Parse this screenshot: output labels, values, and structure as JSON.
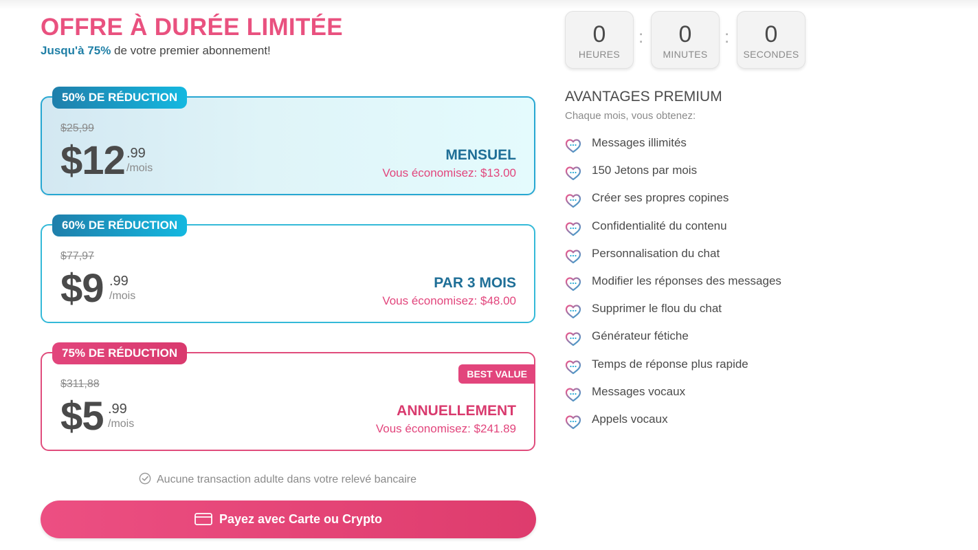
{
  "offer": {
    "headline": "OFFRE À DURÉE LIMITÉE",
    "subline_highlight": "Jusqu'à 75%",
    "subline_rest": " de votre premier abonnement!"
  },
  "plans": [
    {
      "badge": "50% DE RÉDUCTION",
      "old_price": "$25,99",
      "price_main": "$12",
      "price_cents": ".99",
      "per": "/mois",
      "name": "MENSUEL",
      "savings": "Vous économisez: $13.00",
      "selected": true
    },
    {
      "badge": "60% DE RÉDUCTION",
      "old_price": "$77,97",
      "price_main": "$9",
      "price_cents": ".99",
      "per": "/mois",
      "name": "PAR 3 MOIS",
      "savings": "Vous économisez: $48.00",
      "selected": false
    },
    {
      "badge": "75% DE RÉDUCTION",
      "old_price": "$311,88",
      "price_main": "$5",
      "price_cents": ".99",
      "per": "/mois",
      "name": "ANNUELLEMENT",
      "savings": "Vous économisez: $241.89",
      "tag": "BEST VALUE",
      "selected": false
    }
  ],
  "notice": "Aucune transaction adulte dans votre relevé bancaire",
  "pay_button": "Payez avec Carte ou Crypto",
  "timer": {
    "hours": "0",
    "hours_label": "HEURES",
    "minutes": "0",
    "minutes_label": "MINUTES",
    "seconds": "0",
    "seconds_label": "SECONDES",
    "separator": ":"
  },
  "premium": {
    "title": "AVANTAGES PREMIUM",
    "subtitle": "Chaque mois, vous obtenez:",
    "perks": [
      "Messages illimités",
      "150 Jetons par mois",
      "Créer ses propres copines",
      "Confidentialité du contenu",
      "Personnalisation du chat",
      "Modifier les réponses des messages",
      "Supprimer le flou du chat",
      "Générateur fétiche",
      "Temps de réponse plus rapide",
      "Messages vocaux",
      "Appels vocaux"
    ],
    "perk_icon": "heart-chat-icon"
  },
  "colors": {
    "accent_pink": "#e9517f",
    "accent_blue": "#1f7fab",
    "text": "#4a4a4a",
    "muted": "#8a8a8a"
  }
}
